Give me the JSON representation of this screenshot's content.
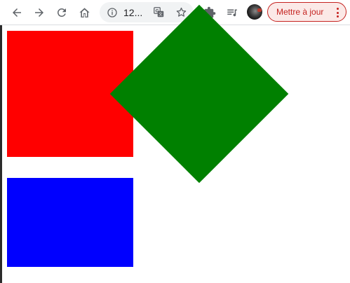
{
  "toolbar": {
    "address_text": "12...",
    "update_label": "Mettre à jour",
    "icons": {
      "back": "back-arrow-icon",
      "forward": "forward-arrow-icon",
      "reload": "reload-icon",
      "home": "home-icon",
      "info": "info-icon",
      "translate": "translate-icon",
      "bookmark": "star-icon",
      "extensions": "puzzle-icon",
      "media": "media-queue-icon",
      "menu": "kebab-menu-icon"
    }
  },
  "page": {
    "shapes": [
      {
        "name": "red-square",
        "color": "#ff0000"
      },
      {
        "name": "green-diamond",
        "color": "#008000"
      },
      {
        "name": "blue-rectangle",
        "color": "#0000ff"
      }
    ]
  }
}
